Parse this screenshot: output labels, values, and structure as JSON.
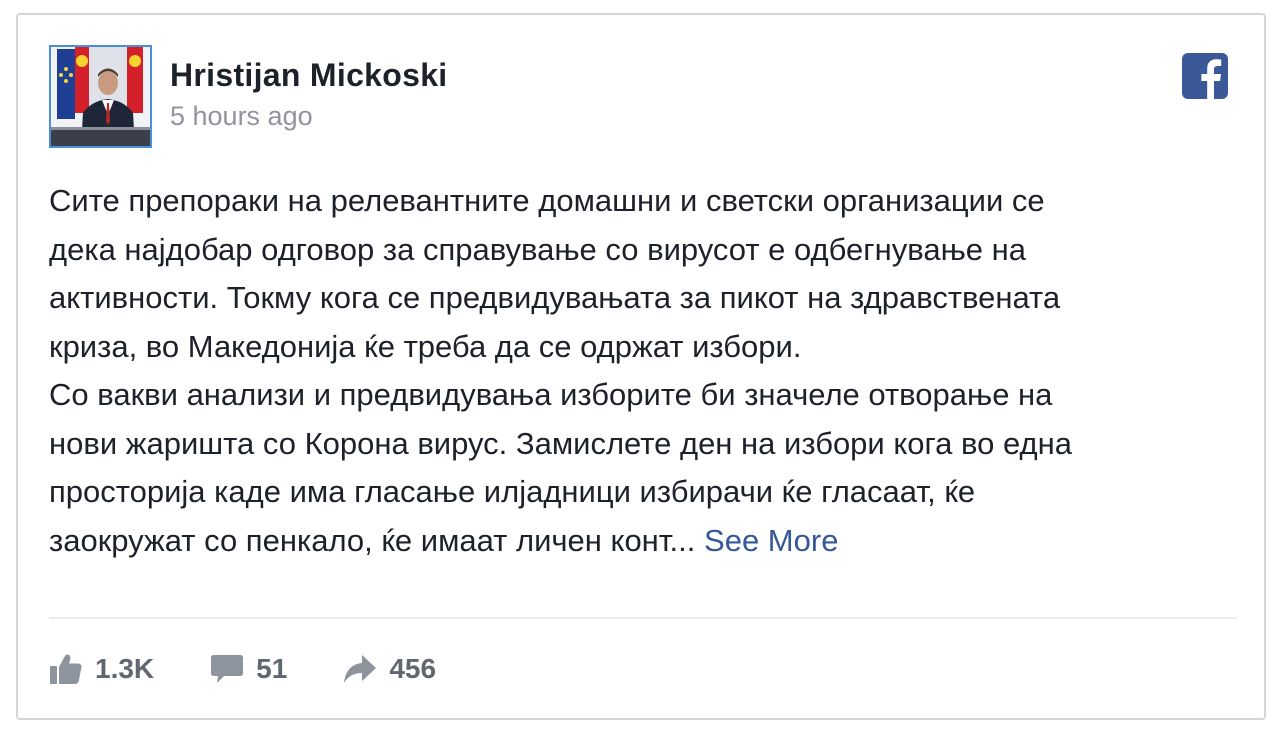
{
  "post": {
    "author": "Hristijan Mickoski",
    "time": "5 hours ago",
    "paragraphs": [
      [
        "Сите препораки на релевантните домашни и светски организации се",
        "дека најдобар одговор за справување со вирусот е одбегнување на",
        "активности. Токму кога се предвидувањата за пикот на здравствената",
        "криза, во Македонија ќе треба да се одржат избори."
      ],
      [
        "Со вакви анализи и предвидувања изборите би значеле отворање на",
        "нови жаришта со Корона вирус. Замислете ден на избори кога во една",
        "просторија каде има гласање илјадници избирачи ќе гласаат, ќе"
      ]
    ],
    "truncated_line": "заокружат со пенкало, ќе имаат личен конт...",
    "see_more_label": "See More"
  },
  "stats": {
    "likes": "1.3K",
    "comments": "51",
    "shares": "456"
  },
  "icons": {
    "platform": "facebook-logo-icon",
    "likes": "thumbs-up-icon",
    "comments": "comment-bubble-icon",
    "shares": "share-arrow-icon"
  },
  "colors": {
    "facebook_blue": "#3b5998",
    "link": "#365899",
    "text": "#1d2129",
    "secondary": "#90949c",
    "stat_icon": "#8d949e"
  }
}
